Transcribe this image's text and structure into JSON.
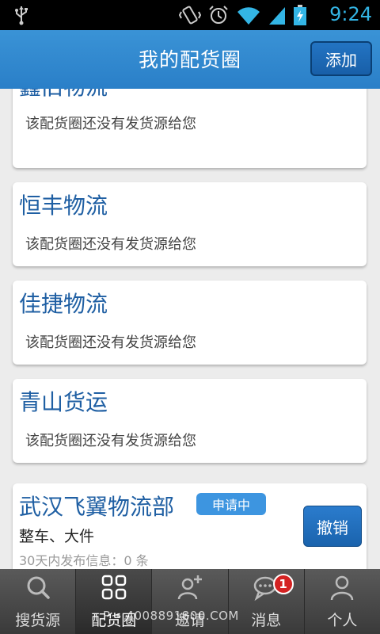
{
  "status_bar": {
    "time": "9:24"
  },
  "header": {
    "title": "我的配货圈",
    "add_label": "添加"
  },
  "cards": [
    {
      "name": "鑫旧物流",
      "message": "该配货圈还没有发货源给您"
    },
    {
      "name": "恒丰物流",
      "message": "该配货圈还没有发货源给您"
    },
    {
      "name": "佳捷物流",
      "message": "该配货圈还没有发货源给您"
    },
    {
      "name": "青山货运",
      "message": "该配货圈还没有发货源给您"
    }
  ],
  "pending_card": {
    "name": "武汉飞翼物流部",
    "badge": "申请中",
    "line1": "整车、大件",
    "line2": "30天内发布信息：0 条",
    "cancel_label": "撤销"
  },
  "tabs": [
    {
      "label": "搜货源",
      "icon": "search-icon"
    },
    {
      "label": "配货圈",
      "icon": "grid-icon",
      "active": true
    },
    {
      "label": "邀请",
      "icon": "add-person-icon"
    },
    {
      "label": "消息",
      "icon": "chat-icon",
      "count": "1"
    },
    {
      "label": "个人",
      "icon": "person-icon"
    }
  ],
  "hotline": "P • 4008891800.COM",
  "colors": {
    "header_blue": "#2a7fc8",
    "card_title_blue": "#1f5fa3",
    "badge_blue": "#3d95e0",
    "notif_red": "#d42222",
    "time_blue": "#33b5e5"
  }
}
